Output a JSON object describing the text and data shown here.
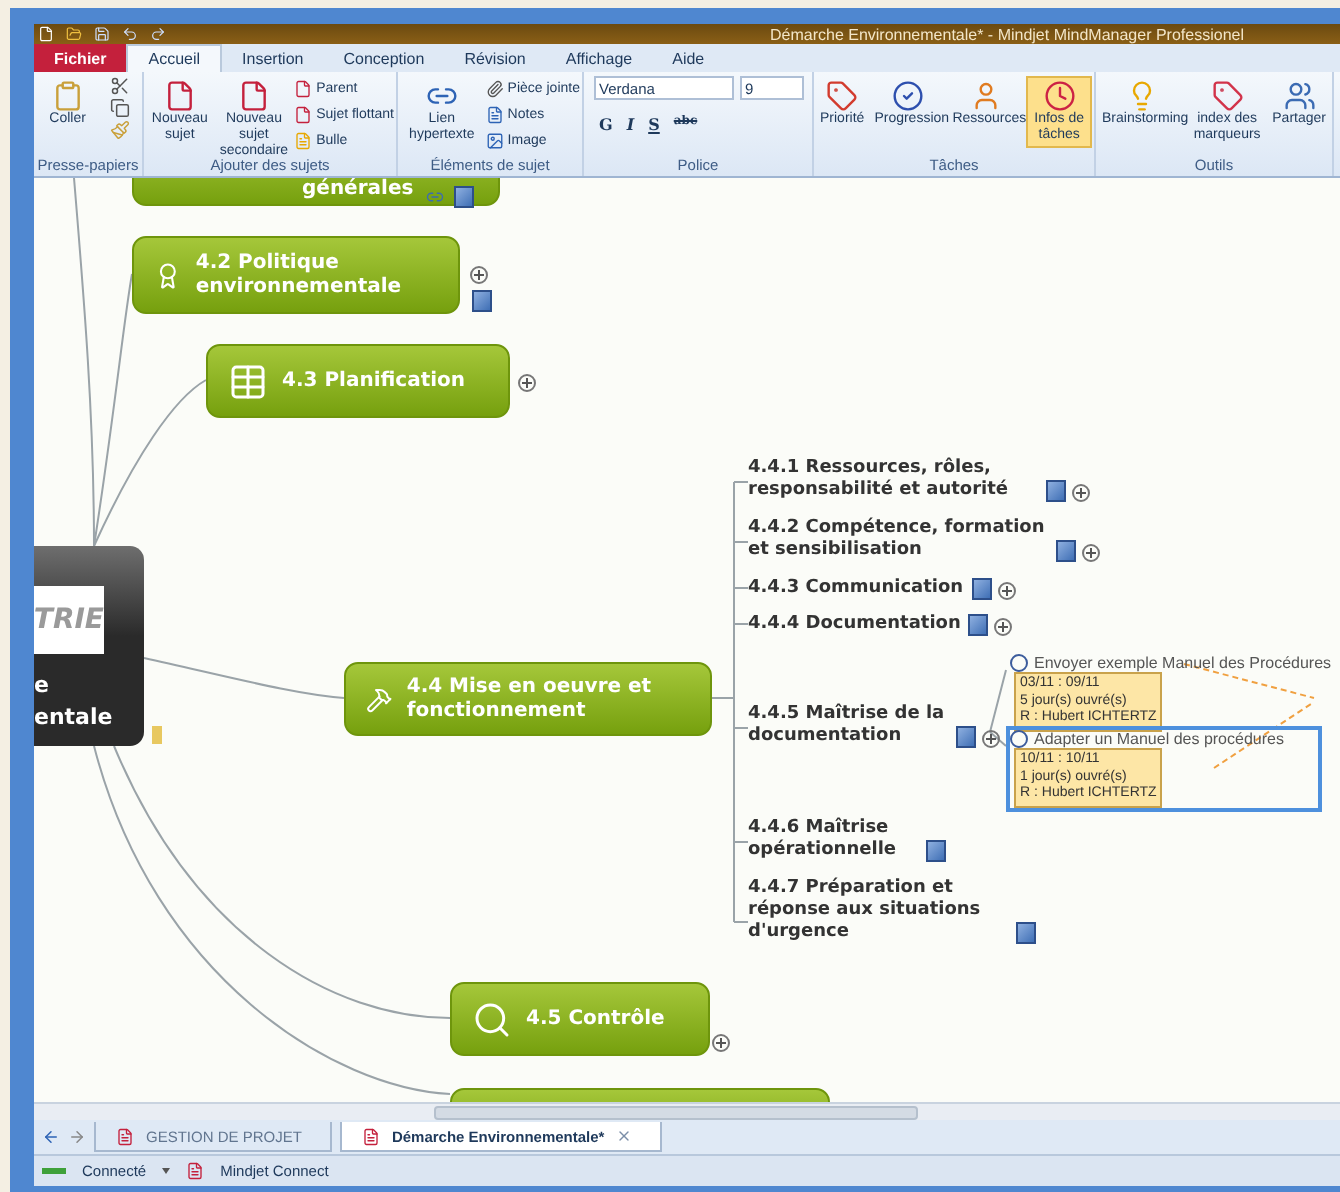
{
  "window": {
    "title": "Démarche Environnementale* - Mindjet MindManager Professionel"
  },
  "file_menu": {
    "label": "Fichier"
  },
  "ribbon_tabs": [
    {
      "label": "Accueil",
      "selected": true
    },
    {
      "label": "Insertion",
      "selected": false
    },
    {
      "label": "Conception",
      "selected": false
    },
    {
      "label": "Révision",
      "selected": false
    },
    {
      "label": "Affichage",
      "selected": false
    },
    {
      "label": "Aide",
      "selected": false
    }
  ],
  "ribbon_groups": [
    {
      "label": "Presse-papiers",
      "kind": "clipboard",
      "buttons": [
        {
          "label": "Coller"
        }
      ]
    },
    {
      "label": "Ajouter des sujets",
      "kind": "topics",
      "buttons": [
        {
          "label": "Nouveau sujet"
        },
        {
          "label": "Nouveau sujet secondaire"
        }
      ],
      "small": [
        {
          "label": "Parent"
        },
        {
          "label": "Sujet flottant"
        },
        {
          "label": "Bulle"
        }
      ]
    },
    {
      "label": "Éléments de sujet",
      "kind": "elements",
      "buttons": [
        {
          "label": "Lien hypertexte"
        }
      ],
      "small": [
        {
          "label": "Pièce jointe"
        },
        {
          "label": "Notes"
        },
        {
          "label": "Image"
        }
      ]
    },
    {
      "label": "Police",
      "kind": "font",
      "font": "Verdana",
      "size": "9",
      "formats": [
        "G",
        "I",
        "S",
        "abc"
      ]
    },
    {
      "label": "Tâches",
      "kind": "tasks",
      "buttons": [
        {
          "label": "Priorité",
          "selected": false
        },
        {
          "label": "Progression",
          "selected": false
        },
        {
          "label": "Ressources",
          "selected": false
        },
        {
          "label": "Infos de tâches",
          "selected": true
        }
      ]
    },
    {
      "label": "Outils",
      "kind": "tools",
      "buttons": [
        {
          "label": "Brainstorming"
        },
        {
          "label": "index des marqueurs"
        },
        {
          "label": "Partager"
        }
      ]
    }
  ],
  "map": {
    "root": {
      "logo": "TRIE",
      "lines": [
        "e",
        "entale"
      ]
    },
    "topics": [
      {
        "label": "générales",
        "kind": "partial"
      },
      {
        "label": "4.2 Politique environnementale",
        "kind": "certificate"
      },
      {
        "label": "4.3 Planification",
        "kind": "table"
      },
      {
        "label": "4.4 Mise en oeuvre et fonctionnement",
        "kind": "tools"
      },
      {
        "label": "4.5 Contrôle",
        "kind": "magnifier"
      },
      {
        "kind": "bottom"
      }
    ],
    "subtopics": [
      {
        "label": "4.4.1 Ressources, rôles, responsabilité et autorité"
      },
      {
        "label": "4.4.2 Compétence, formation et sensibilisation"
      },
      {
        "label": "4.4.3 Communication"
      },
      {
        "label": "4.4.4 Documentation"
      },
      {
        "label": "4.4.5 Maîtrise de la documentation"
      },
      {
        "label": "4.4.6 Maîtrise opérationnelle"
      },
      {
        "label": "4.4.7 Préparation et réponse aux situations d'urgence"
      }
    ],
    "tasks": [
      {
        "title": "Envoyer exemple Manuel des Procédures",
        "dates": "03/11 : 09/11",
        "duration": "5 jour(s) ouvré(s)",
        "resource": "R : Hubert ICHTERTZ",
        "selected": false
      },
      {
        "title": "Adapter un Manuel des procédures",
        "dates": "10/11 : 10/11",
        "duration": "1 jour(s) ouvré(s)",
        "resource": "R : Hubert ICHTERTZ",
        "selected": true
      }
    ]
  },
  "document_tabs": [
    {
      "label": "GESTION DE PROJET",
      "selected": false
    },
    {
      "label": "Démarche Environnementale*",
      "selected": true
    }
  ],
  "status_bar": {
    "connection": "Connecté",
    "service": "Mindjet Connect"
  }
}
